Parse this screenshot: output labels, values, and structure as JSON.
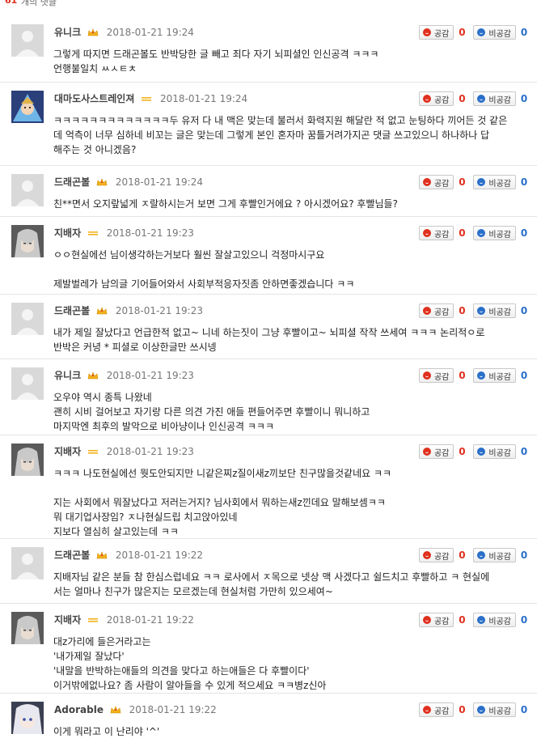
{
  "header": {
    "count": "61",
    "label": "개의 댓글"
  },
  "vote_labels": {
    "like": "공감",
    "dislike": "비공감"
  },
  "comments": [
    {
      "author": "유니크",
      "badge": "crown",
      "date": "2018-01-21 19:24",
      "likes": "0",
      "dislikes": "0",
      "avatar": "default",
      "lines": [
        "그렇게 따지면 드래곤볼도 반박당한 글 빼고 죄다 자기 뇌피셜인 인신공격 ㅋㅋㅋ",
        "언행불일치 ㅆㅅㅌㅊ"
      ]
    },
    {
      "author": "대마도사스트레인져",
      "badge": "bar",
      "date": "2018-01-21 19:24",
      "likes": "0",
      "dislikes": "0",
      "avatar": "mage",
      "lines": [
        "ㅋㅋㅋㅋㅋㅋㅋㅋㅋㅋㅋㅋㅋ두 유저 다 내 맥은 맞는데 불러서 화력지원 해달란 적 없고 눈팅하다 끼어든 것 같은",
        "데 억측이 너무 심하네 비꼬는 글은 맞는데 그렇게 본인 혼자마 꿈틀거려가지곤 댓글 쓰고있으니 하나하나 답",
        "해주는 것 아니겠음?"
      ]
    },
    {
      "author": "드래곤볼",
      "badge": "crown",
      "date": "2018-01-21 19:24",
      "likes": "0",
      "dislikes": "0",
      "avatar": "default",
      "lines": [
        "친**면서 오지랖넓게 ㅈ랄하시는거 보면 그게 후빨인거에요 ? 아시겠어요? 후빨님들?"
      ]
    },
    {
      "author": "지배자",
      "badge": "bar",
      "date": "2018-01-21 19:23",
      "likes": "0",
      "dislikes": "0",
      "avatar": "silver",
      "lines": [
        "ㅇㅇ현실에선 님이생각하는거보다 훨씬 잘살고있으니 걱정마시구요",
        "",
        "제발벌레가 남의글 기어들어와서 사회부적응자짓좀 안하면좋겠습니다 ㅋㅋ"
      ]
    },
    {
      "author": "드래곤볼",
      "badge": "crown",
      "date": "2018-01-21 19:23",
      "likes": "0",
      "dislikes": "0",
      "avatar": "default",
      "lines": [
        "내가 제일 잘났다고 언급한적 없고~ 니네 하는짓이 그냥 후빨이고~ 뇌피셜 작작 쓰세여 ㅋㅋㅋ 논리적ㅇ로",
        "반박은 커녕 * 피셜로 이상한글만 쓰시넹"
      ]
    },
    {
      "author": "유니크",
      "badge": "crown",
      "date": "2018-01-21 19:23",
      "likes": "0",
      "dislikes": "0",
      "avatar": "default",
      "lines": [
        "오우야 역시 종특 나왔네",
        "괜히 시비 걸어보고 자기랑 다른 의견 가진 애들 편들어주면 후빨이니 뭐니하고",
        "마지막엔 최후의 발악으로 비아냥이나 인신공격 ㅋㅋㅋ"
      ]
    },
    {
      "author": "지배자",
      "badge": "bar",
      "date": "2018-01-21 19:23",
      "likes": "0",
      "dislikes": "0",
      "avatar": "silver",
      "lines": [
        "ㅋㅋㅋ 나도현실에선 뭣도안되지만 니같은찌z질이새z끼보단 친구많을것같네요 ㅋㅋ",
        "",
        "지는 사회에서 뭐잘났다고 저러는거지? 님사회에서 뭐하는새z낀데요 말해보셈ㅋㅋ",
        "뭐 대기업사장임? ㅈ나현실드립 치고앉아있네",
        "지보다 열심히 살고있는데 ㅋㅋ"
      ]
    },
    {
      "author": "드래곤볼",
      "badge": "crown",
      "date": "2018-01-21 19:22",
      "likes": "0",
      "dislikes": "0",
      "avatar": "default",
      "lines": [
        "지배자님 같은 분들 참 한심스럽네요 ㅋㅋ 로사에서 ㅈ목으로 넷상 맥 사겠다고 쉴드치고 후빨하고 ㅋ 현실에",
        "서는 얼마나 친구가 많은지는 모르겠는데 현실처럼 가만히 있으세여~"
      ]
    },
    {
      "author": "지배자",
      "badge": "bar",
      "date": "2018-01-21 19:22",
      "likes": "0",
      "dislikes": "0",
      "avatar": "silver",
      "lines": [
        "대z가리에 들은거라고는",
        "'내가제일 잘났다'",
        "'내말을 반박하는애들의 의견을 맞다고 하는애들은 다 후빨이다'",
        "이거밖에없나요? 좀 사람이 알아들을 수 있게 적으세요 ㅋㅋ병z신아"
      ]
    },
    {
      "author": "Adorable",
      "badge": "crown",
      "date": "2018-01-21 19:22",
      "likes": "0",
      "dislikes": "0",
      "avatar": "anime",
      "lines": [
        "이게 뭐라고 이 난리야 '^'"
      ]
    }
  ]
}
